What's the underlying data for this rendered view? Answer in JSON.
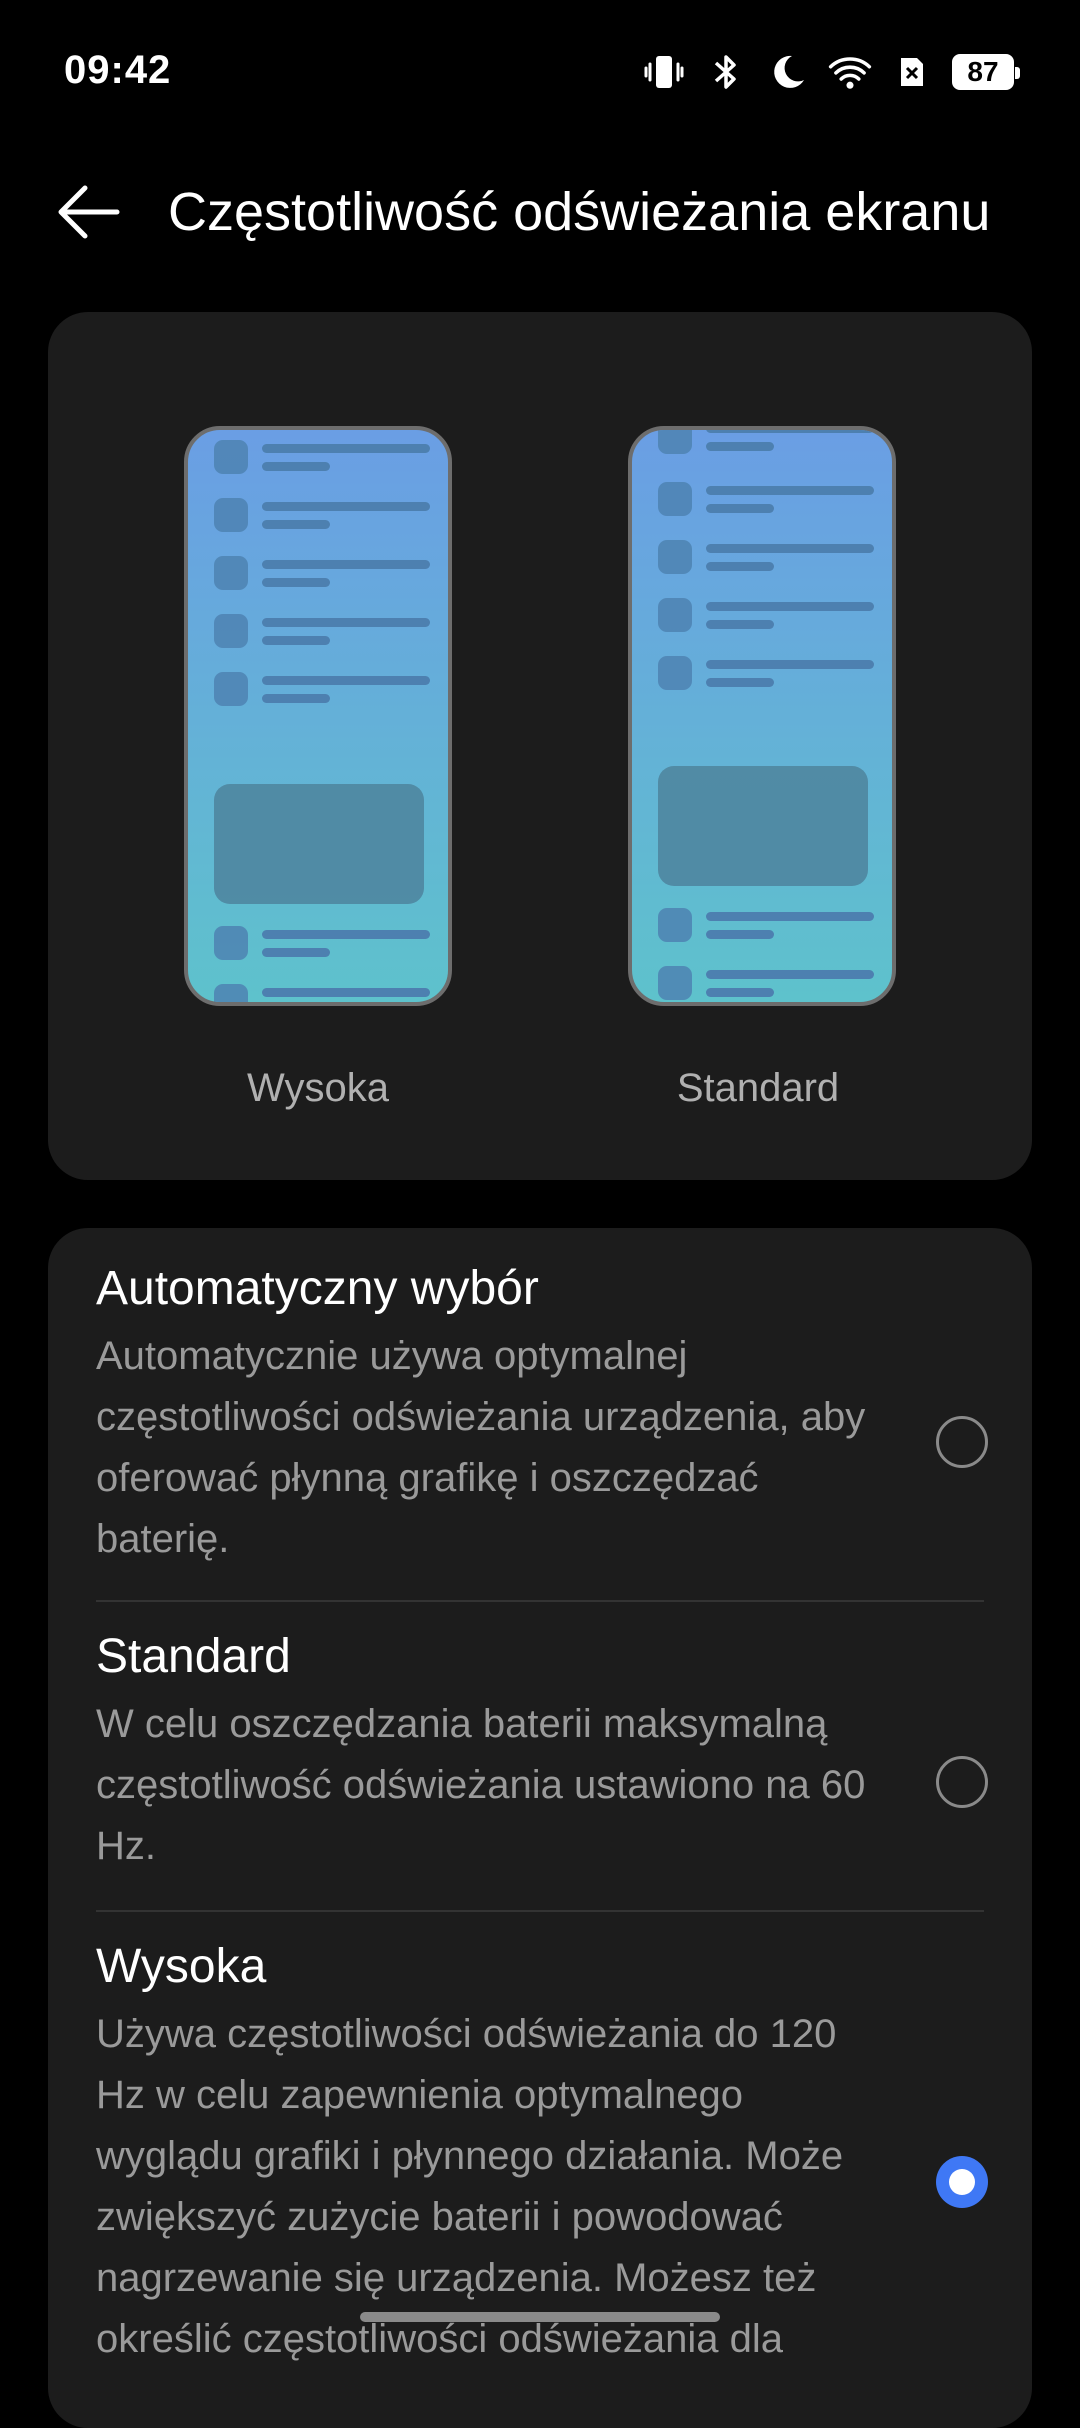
{
  "status_bar": {
    "time": "09:42",
    "battery": "87",
    "icons": [
      "vibrate-icon",
      "bluetooth-icon",
      "moon-icon",
      "wifi-icon",
      "no-sim-icon",
      "battery-icon"
    ]
  },
  "header": {
    "title": "Częstotliwość odświeżania ekranu",
    "back_icon": "back-arrow-icon"
  },
  "preview": {
    "left_label": "Wysoka",
    "right_label": "Standard"
  },
  "options": [
    {
      "title": "Automatyczny wybór",
      "description": "Automatycznie używa optymalnej częstotliwości odświeżania urządzenia, aby oferować płynną grafikę i oszczędzać baterię.",
      "selected": false
    },
    {
      "title": "Standard",
      "description": "W celu oszczędzania baterii maksymalną częstotliwość odświeżania ustawiono na 60 Hz.",
      "selected": false
    },
    {
      "title": "Wysoka",
      "description": "Używa częstotliwości odświeżania do 120 Hz w celu zapewnienia optymalnego wyglądu grafiki i płynnego działania. Może zwiększyć zużycie baterii i powodować nagrzewanie się urządzenia. Możesz też określić częstotliwości odświeżania dla",
      "selected": true
    }
  ],
  "colors": {
    "accent": "#3f78f5",
    "card_bg": "#1c1c1c",
    "background": "#000000"
  }
}
